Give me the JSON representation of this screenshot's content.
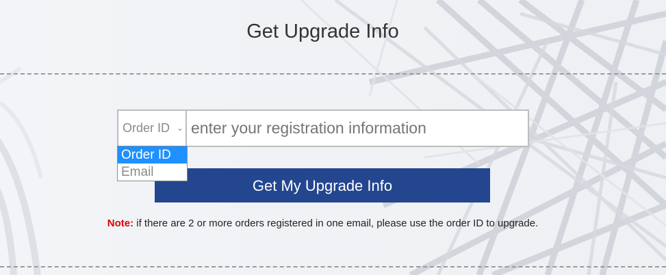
{
  "page": {
    "title": "Get Upgrade Info"
  },
  "search": {
    "type_selected": "Order ID",
    "placeholder": "enter your registration information",
    "type_options": [
      "Order ID",
      "Email"
    ]
  },
  "submit": {
    "label": "Get My Upgrade Info"
  },
  "note": {
    "label": "Note:",
    "text": " if there are 2 or more orders registered in one email, please use the order ID to upgrade."
  },
  "colors": {
    "button_bg": "#23468f",
    "note_label": "#e00000",
    "dropdown_selected": "#1e90ff"
  },
  "icons": {
    "select_arrow": "chevron-down-icon"
  }
}
